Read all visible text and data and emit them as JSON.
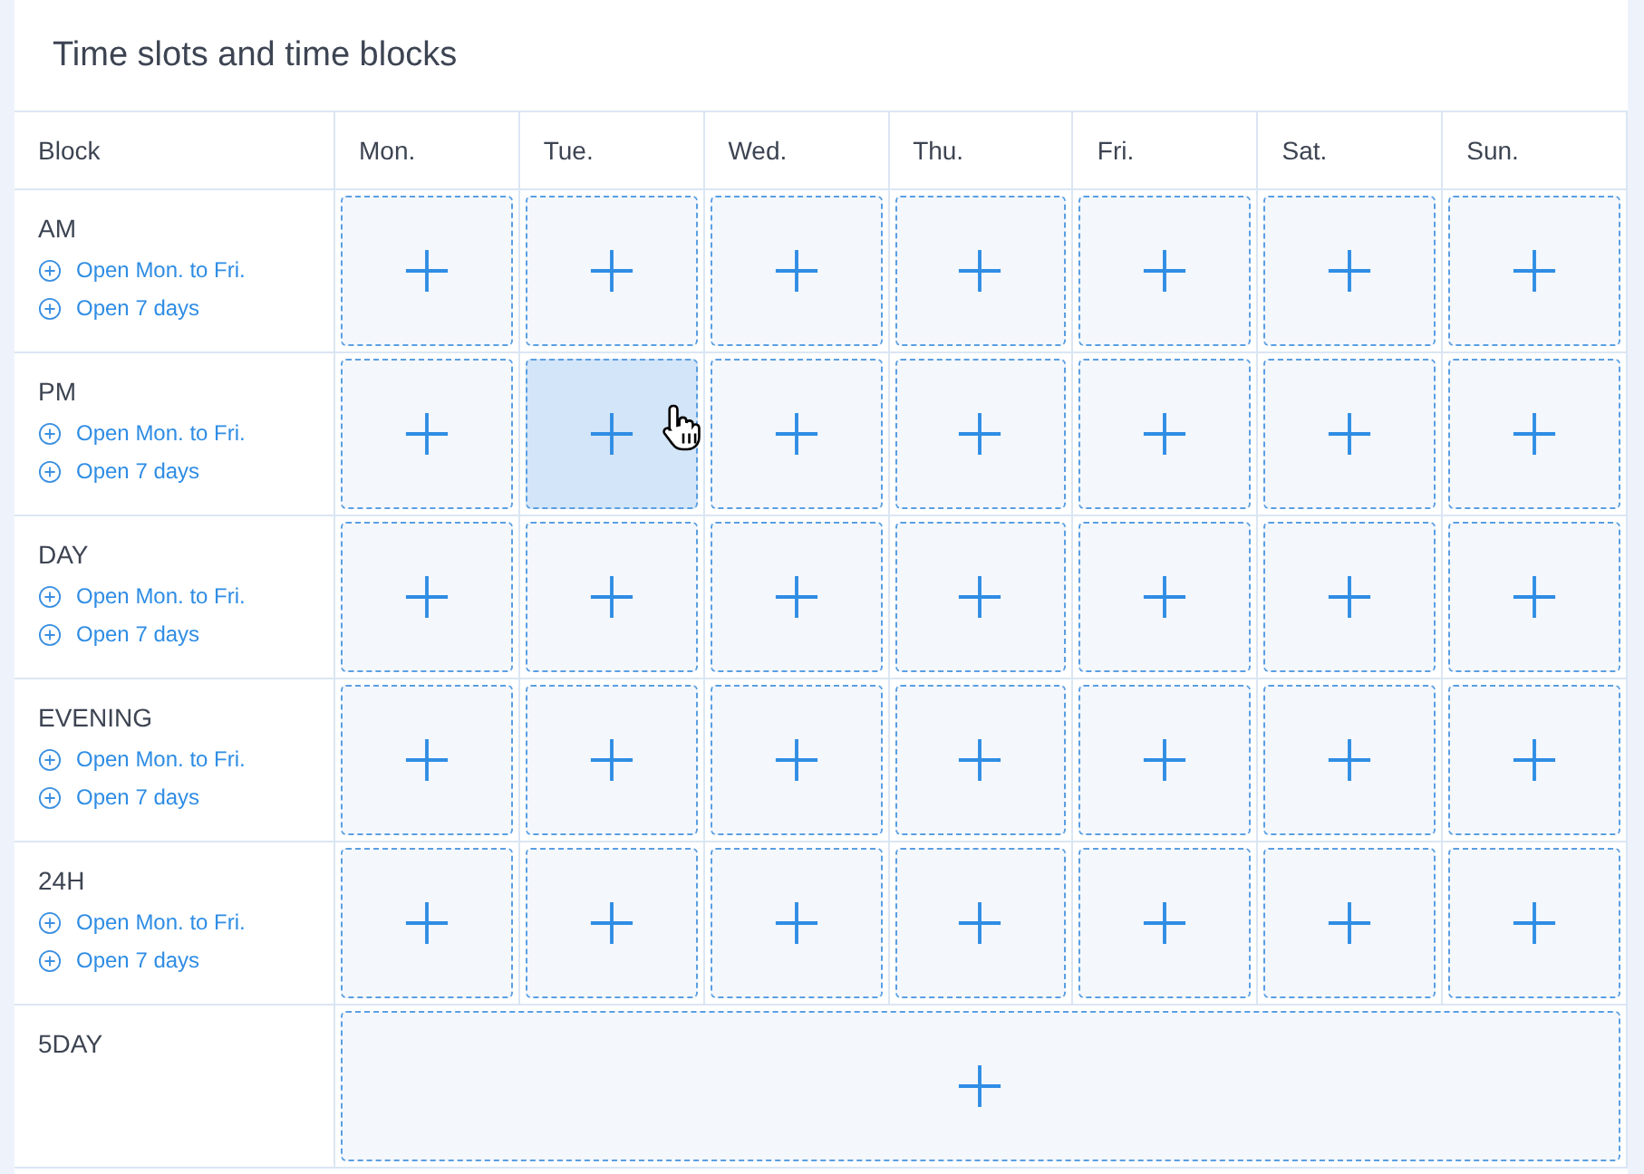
{
  "title": "Time slots and time blocks",
  "columns": [
    "Block",
    "Mon.",
    "Tue.",
    "Wed.",
    "Thu.",
    "Fri.",
    "Sat.",
    "Sun."
  ],
  "rows": [
    {
      "kind": "days",
      "label": "AM",
      "links": [
        "Open Mon. to Fri.",
        "Open 7 days"
      ],
      "cells": [
        {
          "highlighted": false
        },
        {
          "highlighted": false
        },
        {
          "highlighted": false
        },
        {
          "highlighted": false
        },
        {
          "highlighted": false
        },
        {
          "highlighted": false
        },
        {
          "highlighted": false
        }
      ]
    },
    {
      "kind": "days",
      "label": "PM",
      "links": [
        "Open Mon. to Fri.",
        "Open 7 days"
      ],
      "cells": [
        {
          "highlighted": false
        },
        {
          "highlighted": true
        },
        {
          "highlighted": false
        },
        {
          "highlighted": false
        },
        {
          "highlighted": false
        },
        {
          "highlighted": false
        },
        {
          "highlighted": false
        }
      ]
    },
    {
      "kind": "days",
      "label": "DAY",
      "links": [
        "Open Mon. to Fri.",
        "Open 7 days"
      ],
      "cells": [
        {
          "highlighted": false
        },
        {
          "highlighted": false
        },
        {
          "highlighted": false
        },
        {
          "highlighted": false
        },
        {
          "highlighted": false
        },
        {
          "highlighted": false
        },
        {
          "highlighted": false
        }
      ]
    },
    {
      "kind": "days",
      "label": "EVENING",
      "links": [
        "Open Mon. to Fri.",
        "Open 7 days"
      ],
      "cells": [
        {
          "highlighted": false
        },
        {
          "highlighted": false
        },
        {
          "highlighted": false
        },
        {
          "highlighted": false
        },
        {
          "highlighted": false
        },
        {
          "highlighted": false
        },
        {
          "highlighted": false
        }
      ]
    },
    {
      "kind": "days",
      "label": "24H",
      "links": [
        "Open Mon. to Fri.",
        "Open 7 days"
      ],
      "cells": [
        {
          "highlighted": false
        },
        {
          "highlighted": false
        },
        {
          "highlighted": false
        },
        {
          "highlighted": false
        },
        {
          "highlighted": false
        },
        {
          "highlighted": false
        },
        {
          "highlighted": false
        }
      ]
    },
    {
      "kind": "span",
      "label": "5DAY",
      "links": [],
      "cells": [
        {
          "highlighted": false
        }
      ]
    }
  ]
}
